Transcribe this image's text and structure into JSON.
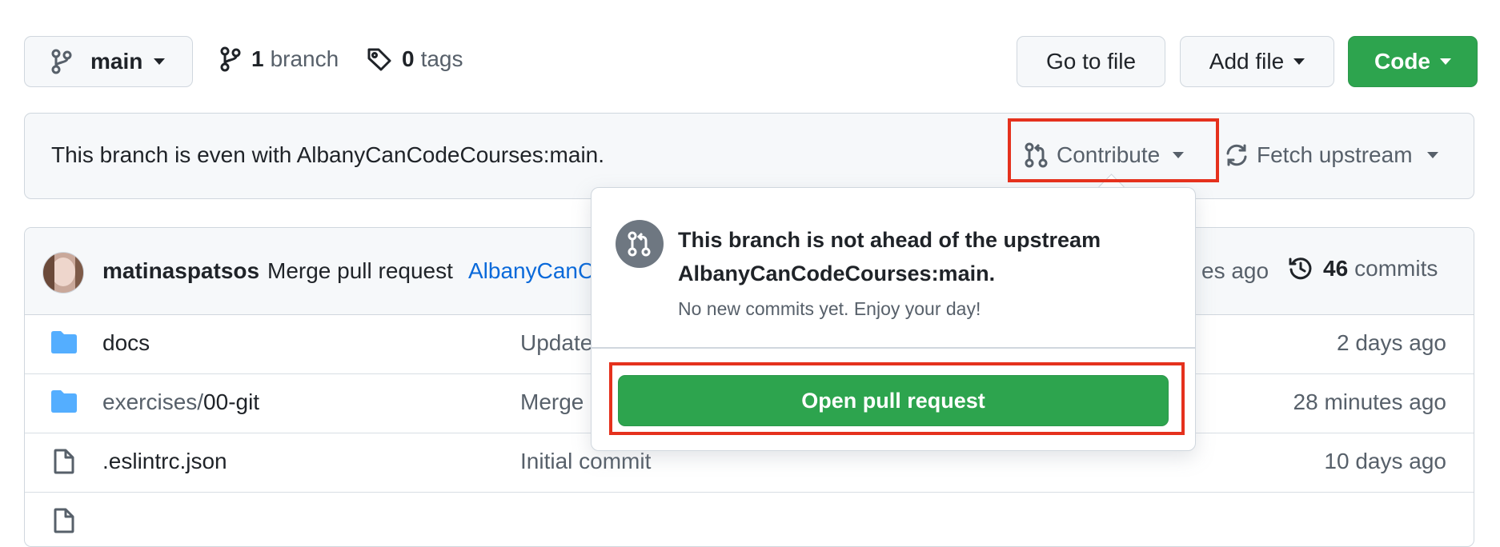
{
  "toolbar": {
    "branch_select": "main",
    "branches_count": "1",
    "branches_label": "branch",
    "tags_count": "0",
    "tags_label": "tags",
    "go_to_file": "Go to file",
    "add_file": "Add file",
    "code": "Code"
  },
  "status_bar": {
    "message": "This branch is even with AlbanyCanCodeCourses:main.",
    "contribute": "Contribute",
    "fetch_upstream": "Fetch upstream"
  },
  "commit_bar": {
    "author": "matinaspatsos",
    "message_prefix": "Merge pull request",
    "message_link": "AlbanyCanC",
    "time_fragment": "es ago",
    "commits_count": "46",
    "commits_label": "commits"
  },
  "files": [
    {
      "name": "docs",
      "type": "folder",
      "message": "Update",
      "age": "2 days ago"
    },
    {
      "name_dir": "exercises/",
      "name": "00-git",
      "type": "folder",
      "message": "Merge",
      "age": "28 minutes ago"
    },
    {
      "name": ".eslintrc.json",
      "type": "file",
      "message": "Initial commit",
      "age": "10 days ago"
    }
  ],
  "contribute_dropdown": {
    "title_line1": "This branch is not ahead of the upstream",
    "title_line2": "AlbanyCanCodeCourses:main.",
    "subtitle": "No new commits yet. Enjoy your day!",
    "open_pr_button": "Open pull request"
  },
  "colors": {
    "accent_green": "#2da44e",
    "link_blue": "#0969da",
    "highlight_red": "#e5311d",
    "folder_blue": "#54aeff"
  }
}
